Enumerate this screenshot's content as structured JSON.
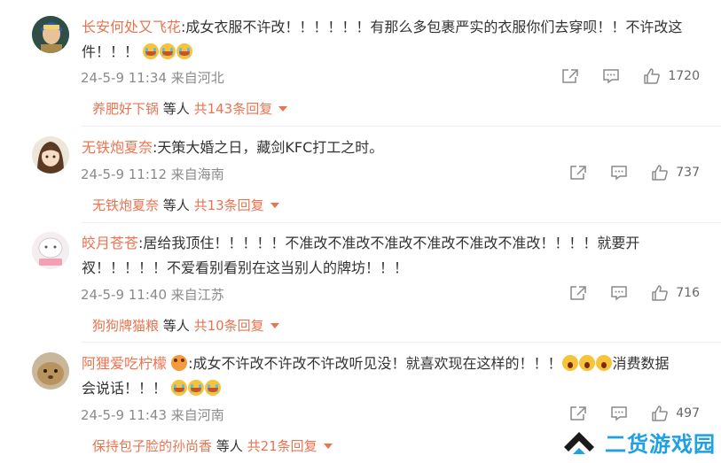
{
  "comments": [
    {
      "username": "长安何处又飞花",
      "text_line1": ":成女衣服不许改！！！！！！有那么多包裹严实的衣服你们去穿呗！！不许改这",
      "text_line2": "件！！！",
      "emojis_line2": [
        "crying-emoji",
        "crying-emoji",
        "crying-emoji"
      ],
      "date": "24-5-9 11:34",
      "source": "来自河北",
      "likes": "1720",
      "reply_name": "养肥好下锅",
      "reply_etc": "等人",
      "reply_total": "共143条回复"
    },
    {
      "username": "无铁炮夏奈",
      "text_line1": ":天策大婚之日，藏剑KFC打工之时。",
      "date": "24-5-9 11:12",
      "source": "来自海南",
      "likes": "737",
      "reply_name": "无铁炮夏奈",
      "reply_etc": "等人",
      "reply_total": "共13条回复"
    },
    {
      "username": "皎月苍苍",
      "text_line1": ":居给我顶住！！！！！不准改不准改不准改不准改不准改不准改！！！！就要开",
      "text_line2": "衩！！！！！不爱看别看别在这当别人的牌坊！！！",
      "date": "24-5-9 11:40",
      "source": "来自江苏",
      "likes": "716",
      "reply_name": "狗狗牌猫粮",
      "reply_etc": "等人",
      "reply_total": "共10条回复"
    },
    {
      "username": "阿狸爱吃柠檬",
      "text_line1": ":成女不许改不许改不许改听见没！就喜欢现在这样的！！！",
      "text_line1_tail": "消费数据",
      "text_line2": "会说话！！！",
      "date": "24-5-9 11:43",
      "source": "来自河南",
      "likes": "497",
      "reply_name": "保持包子脸的孙尚香",
      "reply_etc": "等人",
      "reply_total": "共21条回复"
    }
  ],
  "watermark": {
    "text": "二货游戏园",
    "color": "#1f9fe4"
  },
  "colors": {
    "accent": "#eb7350",
    "meta": "#8a8a8a"
  },
  "icons": [
    "share-icon",
    "comment-icon",
    "like-icon",
    "caret-down-icon"
  ]
}
